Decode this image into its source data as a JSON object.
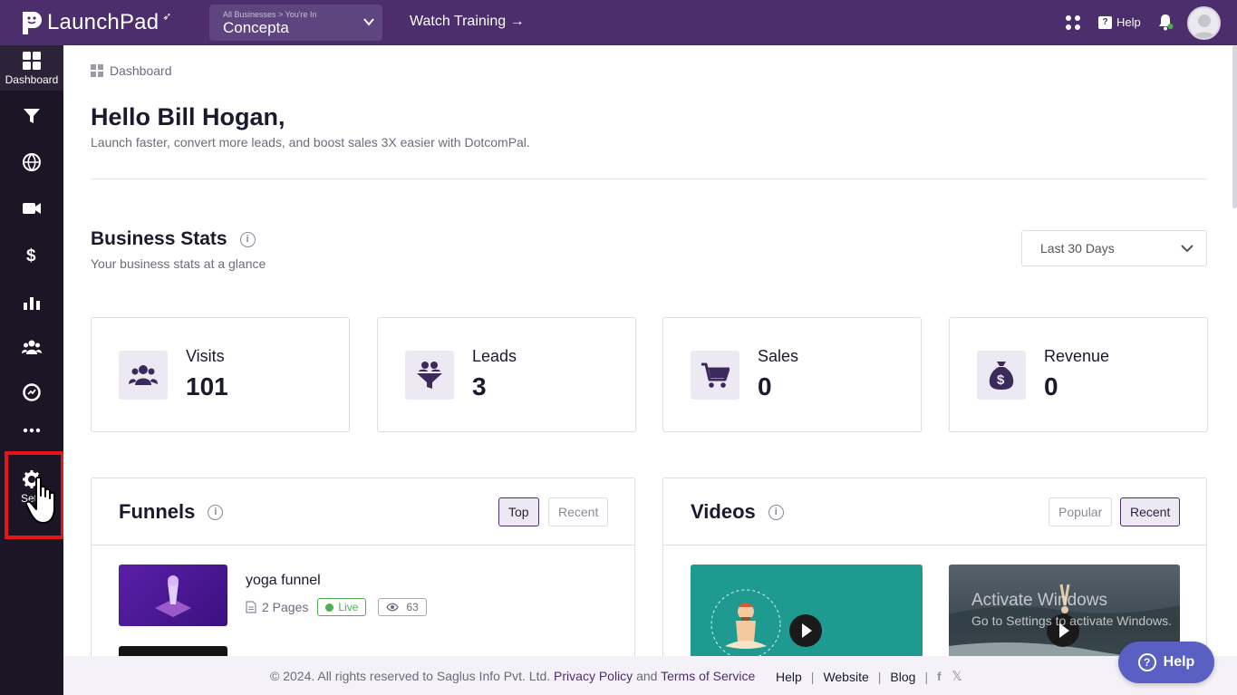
{
  "topbar": {
    "app_name": "LaunchPad",
    "biz_crumb": "All Businesses  >  You're In",
    "biz_name": "Concepta",
    "watch_training": "Watch Training →",
    "help_label": "Help"
  },
  "sidebar": {
    "items": [
      {
        "label": "Dashboard",
        "icon": "dashboard-icon"
      },
      {
        "label": "",
        "icon": "funnel-icon"
      },
      {
        "label": "",
        "icon": "globe-icon"
      },
      {
        "label": "",
        "icon": "video-icon"
      },
      {
        "label": "",
        "icon": "dollar-icon"
      },
      {
        "label": "",
        "icon": "chart-icon"
      },
      {
        "label": "",
        "icon": "people-icon"
      },
      {
        "label": "",
        "icon": "analytics-icon"
      },
      {
        "label": "",
        "icon": "more-icon"
      }
    ],
    "settings_label": "Setti"
  },
  "breadcrumb": {
    "label": "Dashboard"
  },
  "greeting": {
    "title": "Hello Bill Hogan,",
    "subtitle": "Launch faster, convert more leads, and boost sales 3X easier with DotcomPal."
  },
  "stats": {
    "title": "Business Stats",
    "subtitle": "Your business stats at a glance",
    "range": "Last 30 Days",
    "cards": [
      {
        "label": "Visits",
        "value": "101",
        "icon": "visitors-icon"
      },
      {
        "label": "Leads",
        "value": "3",
        "icon": "leads-funnel-icon"
      },
      {
        "label": "Sales",
        "value": "0",
        "icon": "cart-icon"
      },
      {
        "label": "Revenue",
        "value": "0",
        "icon": "money-bag-icon"
      }
    ]
  },
  "funnels": {
    "title": "Funnels",
    "tabs": [
      "Top",
      "Recent"
    ],
    "active_tab": "Top",
    "items": [
      {
        "name": "yoga funnel",
        "pages": "2 Pages",
        "status": "Live",
        "views": "63"
      }
    ]
  },
  "videos": {
    "title": "Videos",
    "tabs": [
      "Popular",
      "Recent"
    ],
    "active_tab": "Recent"
  },
  "watermark": {
    "line1": "Activate Windows",
    "line2": "Go to Settings to activate Windows."
  },
  "footer": {
    "copyright": "©  2024. All rights reserved to Saglus Info Pvt. Ltd.",
    "privacy": "Privacy Policy",
    "and": "and",
    "terms": "Terms of Service",
    "links": [
      "Help",
      "Website",
      "Blog"
    ]
  },
  "help_fab": "Help",
  "colors": {
    "brand": "#4b2e6b",
    "sidebar": "#1c1526",
    "accent": "#5a5fc4",
    "live": "#4caf50"
  }
}
